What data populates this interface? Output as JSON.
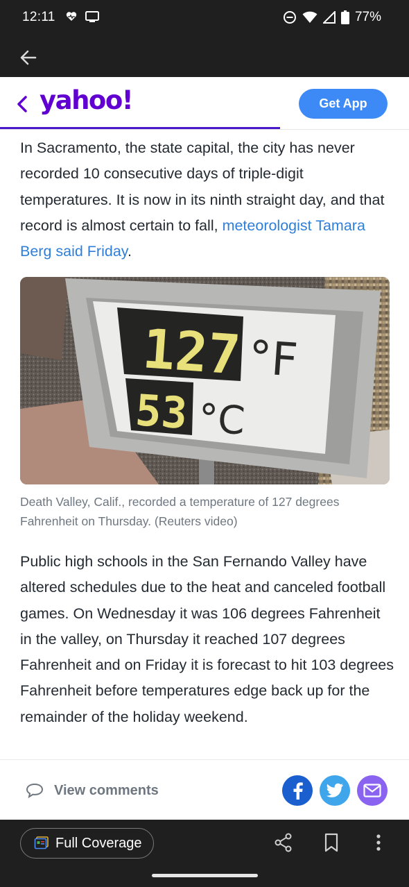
{
  "status_bar": {
    "time": "12:11",
    "battery_percent": "77%",
    "icons": [
      "heart-rate-icon",
      "screen-icon",
      "do-not-disturb-icon",
      "wifi-icon",
      "signal-icon",
      "battery-icon"
    ]
  },
  "header": {
    "logo": "yahoo!",
    "get_app_label": "Get App",
    "reading_progress": 0.685
  },
  "article": {
    "paragraph1_text": "In Sacramento, the state capital, the city has never recorded 10 consecutive days of triple-digit temperatures. It is now in its ninth straight day, and that record is almost certain to fall, ",
    "paragraph1_link": "meteorologist Tamara Berg said Friday",
    "paragraph1_end": ".",
    "photo": {
      "fahrenheit_value": "127",
      "fahrenheit_unit": "°F",
      "celsius_value": "53",
      "celsius_unit": "°C"
    },
    "caption": "Death Valley, Calif., recorded a temperature of 127 degrees Fahrenheit on Thursday. (Reuters video)",
    "paragraph2": "Public high schools in the San Fernando Valley have altered schedules due to the heat and canceled football games. On Wednesday it was 106 degrees Fahrenheit in the valley, on Thursday it reached 107 degrees Fahrenheit and on Friday it is forecast to hit 103 degrees Fahrenheit before temperatures edge back up for the remainder of the holiday weekend."
  },
  "share_bar": {
    "comments_label": "View comments",
    "share_targets": [
      "facebook-icon",
      "twitter-icon",
      "email-icon"
    ]
  },
  "bottom_bar": {
    "full_coverage_label": "Full Coverage"
  },
  "colors": {
    "yahoo_purple": "#6001d2",
    "get_app_blue": "#3d8af7",
    "link_blue": "#2f7fd9",
    "facebook_blue": "#1b5fcf",
    "twitter_blue": "#3fa6ec",
    "email_purple": "#8a63f0",
    "dark_bar": "#1f1f1f"
  }
}
